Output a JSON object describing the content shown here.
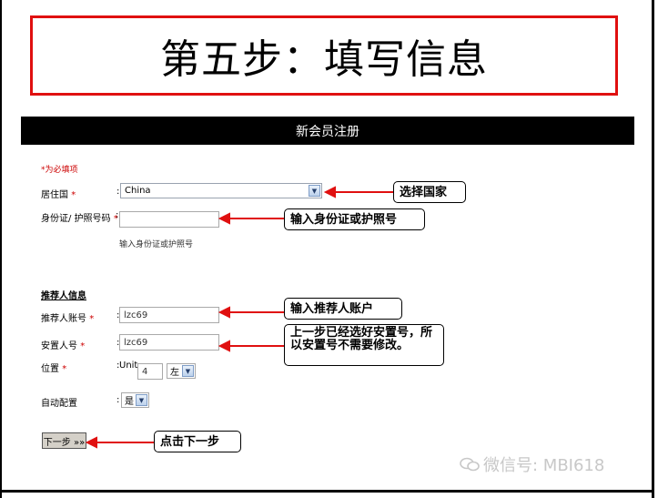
{
  "title": "第五步：填写信息",
  "form": {
    "header": "新会员注册",
    "required_note": "*为必填项",
    "country": {
      "label": "居住国",
      "star": "*",
      "value": "China"
    },
    "id_number": {
      "label": "身份证/ 护照号码",
      "star": "*",
      "value": "",
      "hint": "输入身份证或护照号"
    },
    "section_referrer": "推荐人信息",
    "referrer_account": {
      "label": "推荐人账号",
      "star": "*",
      "value": "lzc69"
    },
    "placement_id": {
      "label": "安置人号",
      "star": "*",
      "value": "lzc69"
    },
    "position": {
      "label": "位置",
      "star": "*",
      "unit_label": "Unit",
      "unit_value": "4",
      "side_value": "左"
    },
    "auto_config": {
      "label": "自动配置",
      "value": "是"
    },
    "colon": ":",
    "next_button": "下一步 »»"
  },
  "callouts": {
    "select_country": "选择国家",
    "enter_id": "输入身份证或护照号",
    "enter_referrer": "输入推荐人账户",
    "placement_note": "上一步已经选好安置号，所以安置号不需要修改。",
    "click_next": "点击下一步"
  },
  "watermark": "微信号: MBI618",
  "colors": {
    "accent_red": "#e01010",
    "header_bg": "#000000"
  }
}
